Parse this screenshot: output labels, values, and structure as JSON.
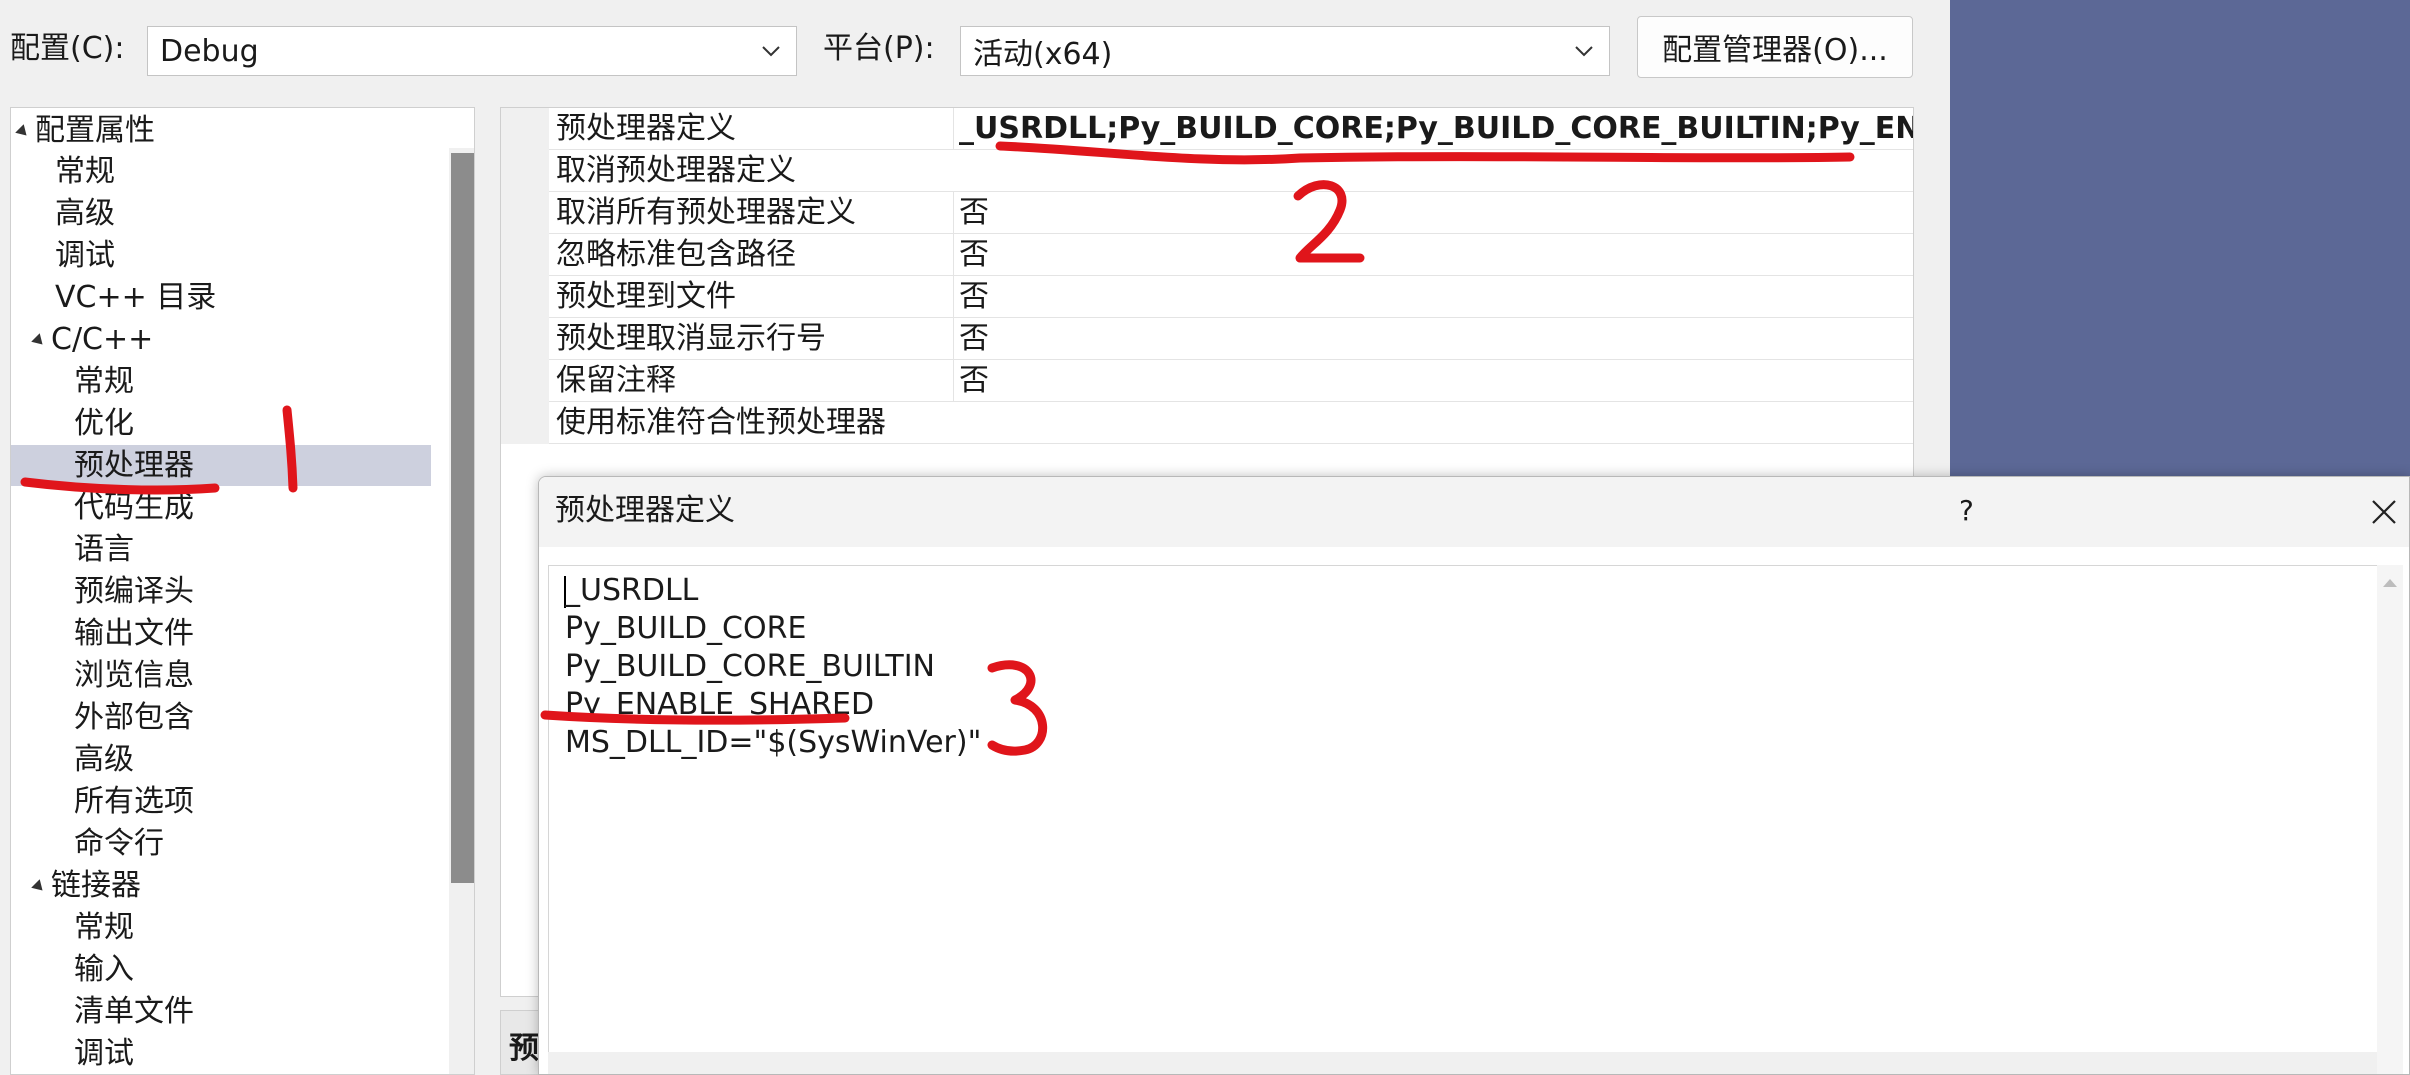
{
  "toolbar": {
    "config_label": "配置(C):",
    "config_value": "Debug",
    "platform_label": "平台(P):",
    "platform_value": "活动(x64)",
    "config_manager_button": "配置管理器(O)..."
  },
  "tree": {
    "items": [
      {
        "label": "配置属性"
      },
      {
        "label": "常规"
      },
      {
        "label": "高级"
      },
      {
        "label": "调试"
      },
      {
        "label": "VC++ 目录"
      },
      {
        "label": "C/C++"
      },
      {
        "label": "常规"
      },
      {
        "label": "优化"
      },
      {
        "label": "预处理器"
      },
      {
        "label": "代码生成"
      },
      {
        "label": "语言"
      },
      {
        "label": "预编译头"
      },
      {
        "label": "输出文件"
      },
      {
        "label": "浏览信息"
      },
      {
        "label": "外部包含"
      },
      {
        "label": "高级"
      },
      {
        "label": "所有选项"
      },
      {
        "label": "命令行"
      },
      {
        "label": "链接器"
      },
      {
        "label": "常规"
      },
      {
        "label": "输入"
      },
      {
        "label": "清单文件"
      },
      {
        "label": "调试"
      }
    ]
  },
  "grid": {
    "rows": [
      {
        "name": "预处理器定义",
        "value": "_USRDLL;Py_BUILD_CORE;Py_BUILD_CORE_BUILTIN;Py_ENABLE_S"
      },
      {
        "name": "取消预处理器定义",
        "value": ""
      },
      {
        "name": "取消所有预处理器定义",
        "value": "否"
      },
      {
        "name": "忽略标准包含路径",
        "value": "否"
      },
      {
        "name": "预处理到文件",
        "value": "否"
      },
      {
        "name": "预处理取消显示行号",
        "value": "否"
      },
      {
        "name": "保留注释",
        "value": "否"
      },
      {
        "name": "使用标准符合性预处理器",
        "value": ""
      }
    ],
    "description_char": "预"
  },
  "dialog": {
    "title": "预处理器定义",
    "help": "?",
    "lines": [
      "_USRDLL",
      "Py_BUILD_CORE",
      "Py_BUILD_CORE_BUILTIN",
      "Py_ENABLE_SHARED",
      "MS_DLL_ID=\"$(SysWinVer)\""
    ]
  },
  "annotations": {
    "color": "#e0151b",
    "marks": [
      "1",
      "2",
      "3"
    ]
  }
}
